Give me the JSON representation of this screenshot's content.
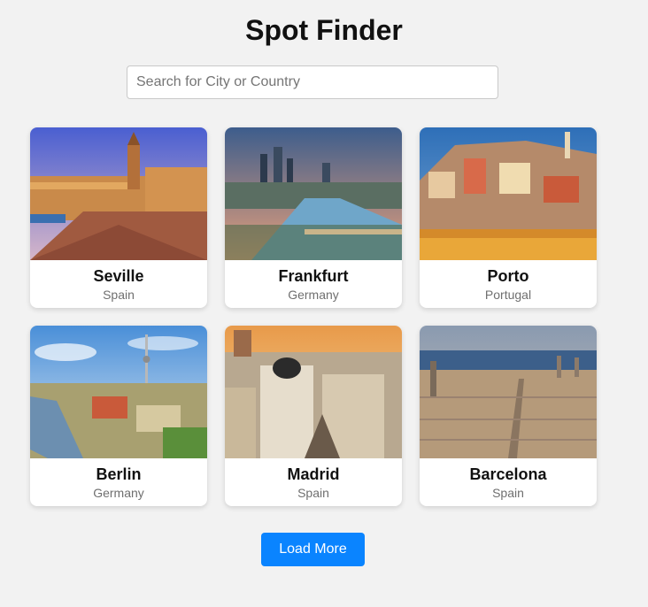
{
  "header": {
    "title": "Spot Finder"
  },
  "search": {
    "placeholder": "Search for City or Country",
    "value": ""
  },
  "cards": [
    {
      "city": "Seville",
      "country": "Spain"
    },
    {
      "city": "Frankfurt",
      "country": "Germany"
    },
    {
      "city": "Porto",
      "country": "Portugal"
    },
    {
      "city": "Berlin",
      "country": "Germany"
    },
    {
      "city": "Madrid",
      "country": "Spain"
    },
    {
      "city": "Barcelona",
      "country": "Spain"
    }
  ],
  "footer": {
    "load_more_label": "Load More"
  },
  "colors": {
    "accent": "#0a84ff",
    "background": "#f2f2f2"
  }
}
